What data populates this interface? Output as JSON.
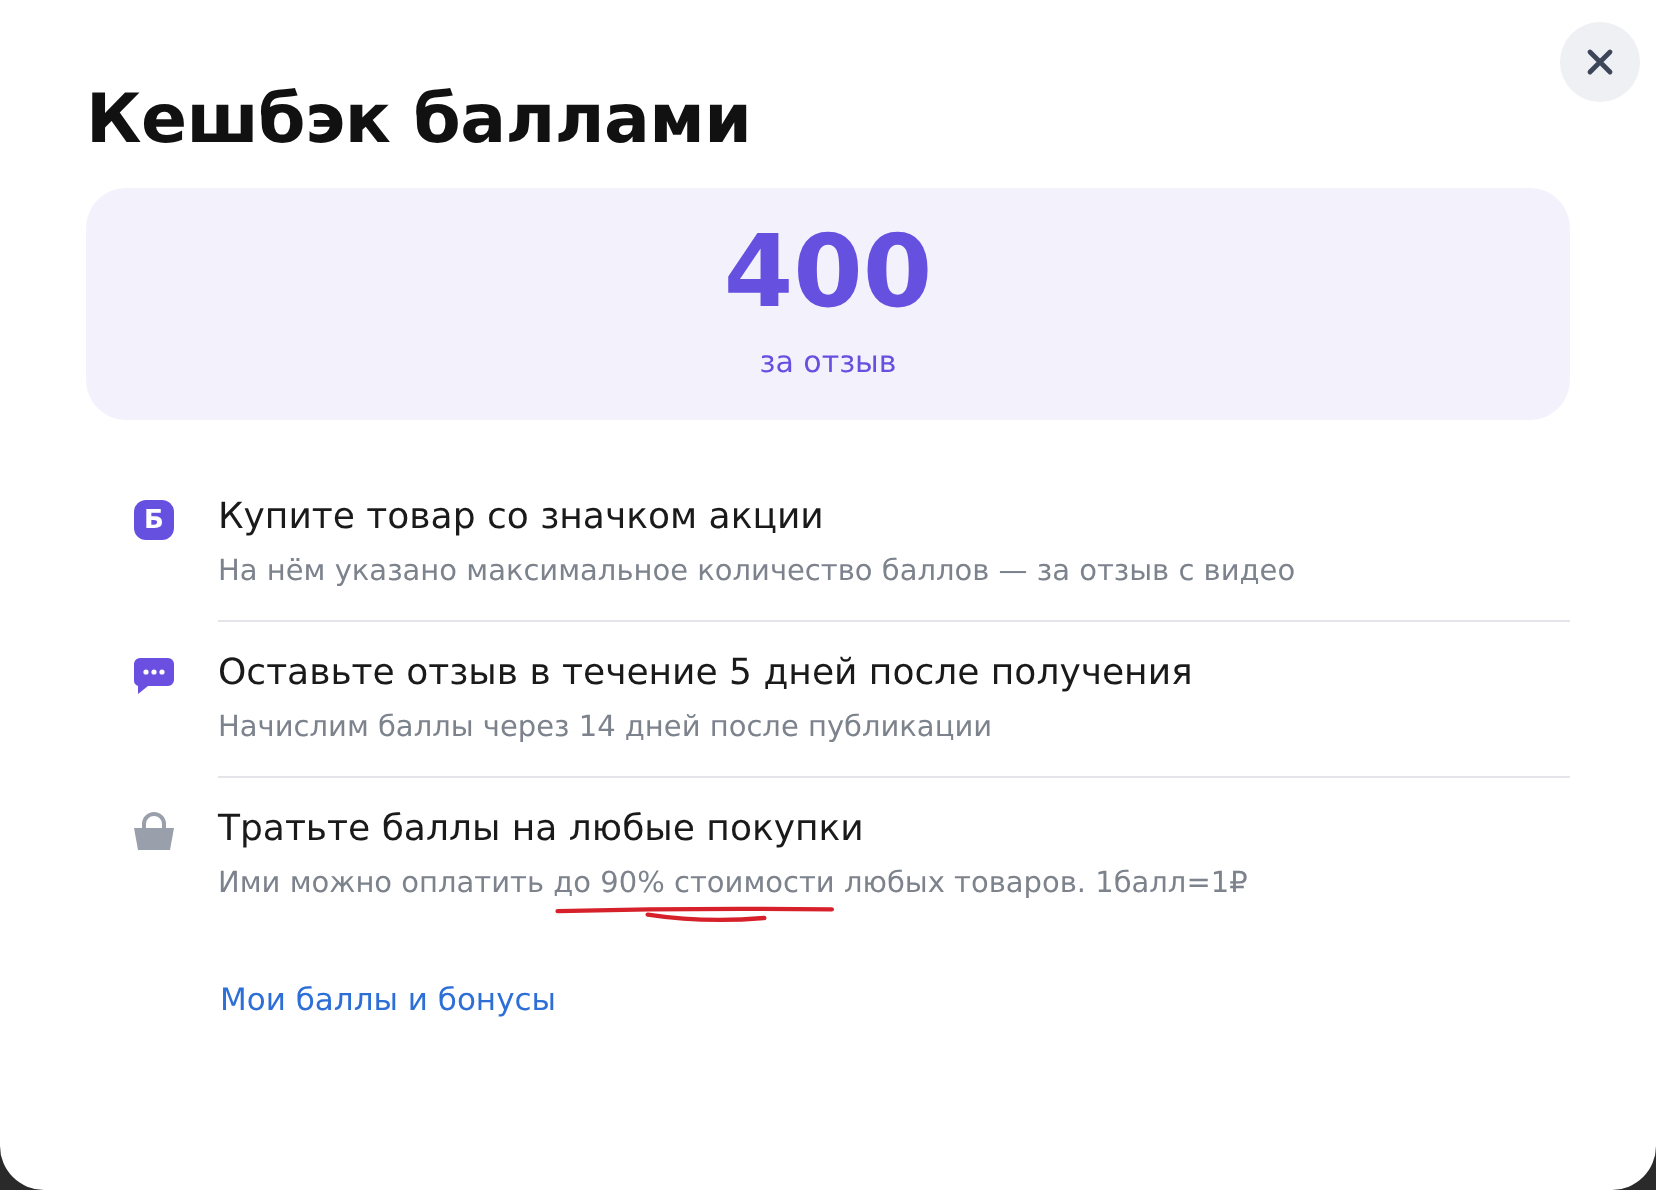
{
  "title": "Кешбэк баллами",
  "cashback": {
    "amount": "400",
    "caption": "за отзыв"
  },
  "steps": [
    {
      "kind": "badge",
      "icon_text": "Б",
      "title": "Купите товар со значком акции",
      "note": [
        "На нём указано максимальное количество баллов — за отзыв с видео"
      ]
    },
    {
      "kind": "chat",
      "title": "Оставьте отзыв в течение 5 дней после получения",
      "note": [
        "Начислим баллы через 14 дней после публикации"
      ]
    },
    {
      "kind": "bag",
      "title": "Тратьте баллы на любые покупки",
      "note": [
        "Ими можно оплатить ",
        "до 90% стоимости",
        " любых товаров. 1балл=1₽"
      ]
    }
  ],
  "link": "Мои баллы и бонусы"
}
